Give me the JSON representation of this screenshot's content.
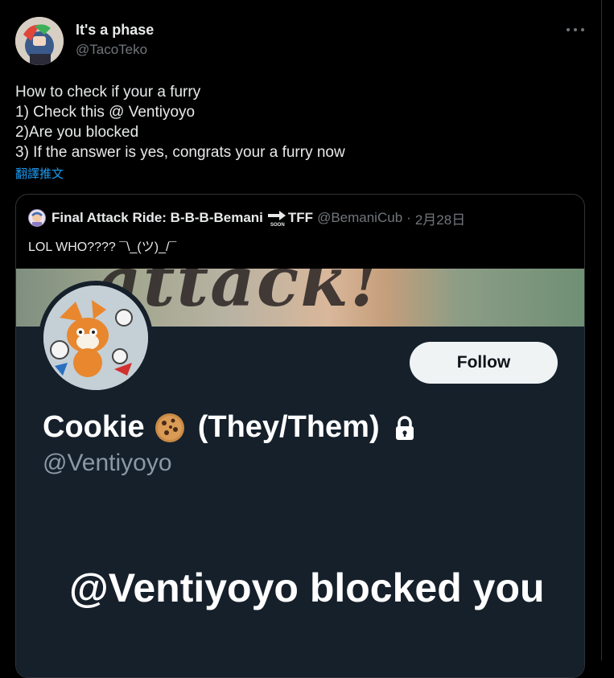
{
  "author": {
    "display_name": "It's a phase",
    "handle": "@TacoTeko"
  },
  "tweet": {
    "lines": [
      "How to check if your a furry",
      "1) Check this @ Ventiyoyo",
      "2)Are you blocked",
      "3) If the answer is yes, congrats your a furry now"
    ],
    "translate_label": "翻譯推文"
  },
  "quote": {
    "display_name": "Final Attack Ride: B-B-B-Bemani",
    "display_name_suffix": "TFF",
    "soon_icon": "soon-arrow-emoji",
    "handle": "@BemaniCub",
    "separator": "·",
    "date": "2月28日",
    "text": "LOL WHO???? ¯\\_(ツ)_/¯"
  },
  "screenshot": {
    "banner_word": "attack!",
    "follow_label": "Follow",
    "profile_name_part1": "Cookie",
    "profile_name_part2": "(They/Them)",
    "profile_handle": "@Ventiyoyo",
    "blocked_message": "@Ventiyoyo blocked you",
    "icons": [
      "cookie-icon",
      "lock-icon"
    ]
  },
  "colors": {
    "background": "#000000",
    "text": "#e7e9ea",
    "secondary": "#71767b",
    "link": "#1d9bf0",
    "profile_bg": "#15202b"
  }
}
